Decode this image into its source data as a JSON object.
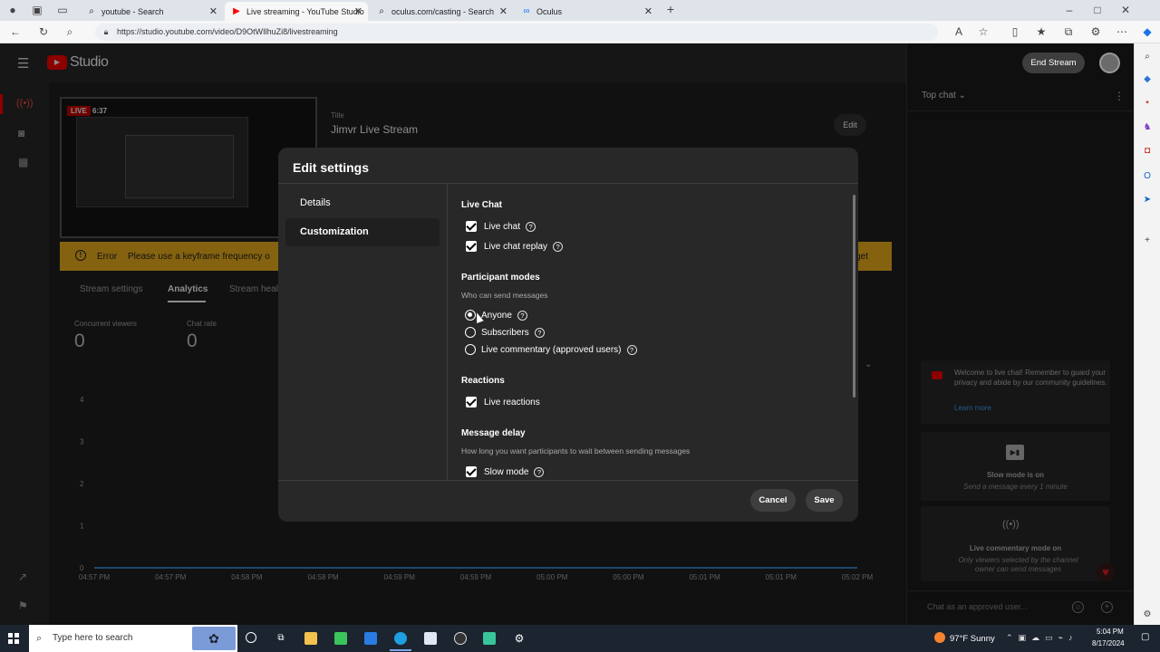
{
  "browser": {
    "tabs": [
      {
        "title": "youtube - Search",
        "icon": "search-icon"
      },
      {
        "title": "Live streaming - YouTube Studio",
        "icon": "youtube-icon"
      },
      {
        "title": "oculus.com/casting - Search",
        "icon": "search-icon"
      },
      {
        "title": "Oculus",
        "icon": "meta-icon"
      }
    ],
    "url": "https://studio.youtube.com/video/D9OtWIlhuZi8/livestreaming"
  },
  "header": {
    "logo_text": "Studio",
    "end_stream_label": "End Stream"
  },
  "stream": {
    "live_badge": "LIVE",
    "elapsed": "6:37",
    "title_label": "Title",
    "title_value": "Jimvr Live Stream",
    "edit_label": "Edit",
    "error_label": "Error",
    "error_text": "Please use a keyframe frequency o",
    "error_tail": "get",
    "tabs": [
      "Stream settings",
      "Analytics",
      "Stream heal"
    ],
    "metrics": [
      {
        "label": "Concurrent viewers",
        "value": "0"
      },
      {
        "label": "Chat rate",
        "value": "0"
      }
    ]
  },
  "chart_data": {
    "type": "line",
    "x": [
      "04:57 PM",
      "04:57 PM",
      "04:58 PM",
      "04:58 PM",
      "04:59 PM",
      "04:59 PM",
      "05:00 PM",
      "05:00 PM",
      "05:01 PM",
      "05:01 PM",
      "05:02 PM"
    ],
    "yticks": [
      0,
      1,
      2,
      3,
      4
    ],
    "ylim": [
      0,
      4
    ],
    "series": [
      {
        "values": [
          0,
          0,
          0,
          0,
          0,
          0,
          0,
          0,
          0,
          0,
          0
        ]
      }
    ],
    "color": "#3ea6ff",
    "grid": false
  },
  "modal": {
    "title": "Edit settings",
    "sidebar": [
      "Details",
      "Customization"
    ],
    "live_chat": {
      "heading": "Live Chat",
      "options": [
        "Live chat",
        "Live chat replay"
      ]
    },
    "participant": {
      "heading": "Participant modes",
      "subtitle": "Who can send messages",
      "options": [
        "Anyone",
        "Subscribers",
        "Live commentary (approved users)"
      ]
    },
    "reactions": {
      "heading": "Reactions",
      "options": [
        "Live reactions"
      ]
    },
    "delay": {
      "heading": "Message delay",
      "subtitle": "How long you want participants to wait between sending messages",
      "options": [
        "Slow mode"
      ]
    },
    "cancel_label": "Cancel",
    "save_label": "Save",
    "help_glyph": "?"
  },
  "chat": {
    "top_chat": "Top chat",
    "welcome": "Welcome to live chat! Remember to guard your privacy and abide by our community guidelines.",
    "learn_more": "Learn more",
    "slow_title": "Slow mode is on",
    "slow_sub": "Send a message every 1 minute",
    "commentary_title": "Live commentary mode on",
    "commentary_sub": "Only viewers selected by the channel owner can send messages",
    "input_placeholder": "Chat as an approved user..."
  },
  "taskbar": {
    "search_placeholder": "Type here to search",
    "weather": "97°F Sunny",
    "time": "5:04 PM",
    "date": "8/17/2024"
  },
  "colors": {
    "accent_red": "#ff0000",
    "error_yellow": "#f0b31c",
    "link_blue": "#3ea6ff"
  }
}
